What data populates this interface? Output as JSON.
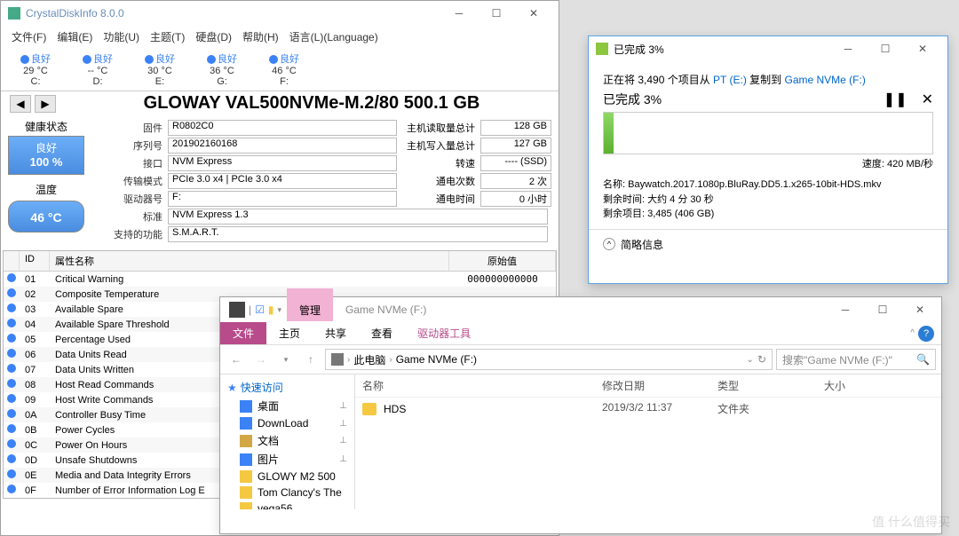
{
  "cdi": {
    "title": "CrystalDiskInfo 8.0.0",
    "menu": [
      "文件(F)",
      "编辑(E)",
      "功能(U)",
      "主题(T)",
      "硬盘(D)",
      "帮助(H)",
      "语言(L)(Language)"
    ],
    "drives": [
      {
        "status": "良好",
        "temp": "29 °C",
        "letter": "C:"
      },
      {
        "status": "良好",
        "temp": "-- °C",
        "letter": "D:"
      },
      {
        "status": "良好",
        "temp": "30 °C",
        "letter": "E:"
      },
      {
        "status": "良好",
        "temp": "36 °C",
        "letter": "G:"
      },
      {
        "status": "良好",
        "temp": "46 °C",
        "letter": "F:"
      }
    ],
    "modelTitle": "GLOWAY VAL500NVMe-M.2/80 500.1 GB",
    "healthLabel": "健康状态",
    "healthStatus": "良好",
    "healthPct": "100 %",
    "tempLabel": "温度",
    "tempVal": "46 °C",
    "fields": {
      "firmware_l": "固件",
      "firmware": "R0802C0",
      "serial_l": "序列号",
      "serial": "201902160168",
      "iface_l": "接口",
      "iface": "NVM Express",
      "transfer_l": "传输模式",
      "transfer": "PCIe 3.0 x4 | PCIe 3.0 x4",
      "drive_l": "驱动器号",
      "drive": "F:",
      "std_l": "标准",
      "std": "NVM Express 1.3",
      "feat_l": "支持的功能",
      "feat": "S.M.A.R.T.",
      "reads_l": "主机读取量总计",
      "reads": "128 GB",
      "writes_l": "主机写入量总计",
      "writes": "127 GB",
      "spin_l": "转速",
      "spin": "---- (SSD)",
      "pon_l": "通电次数",
      "pon": "2 次",
      "hours_l": "通电时间",
      "hours": "0 小时"
    },
    "smartHead": {
      "id": "ID",
      "name": "属性名称",
      "raw": "原始值"
    },
    "smart": [
      {
        "id": "01",
        "name": "Critical Warning",
        "raw": "000000000000"
      },
      {
        "id": "02",
        "name": "Composite Temperature",
        "raw": ""
      },
      {
        "id": "03",
        "name": "Available Spare",
        "raw": ""
      },
      {
        "id": "04",
        "name": "Available Spare Threshold",
        "raw": ""
      },
      {
        "id": "05",
        "name": "Percentage Used",
        "raw": ""
      },
      {
        "id": "06",
        "name": "Data Units Read",
        "raw": ""
      },
      {
        "id": "07",
        "name": "Data Units Written",
        "raw": ""
      },
      {
        "id": "08",
        "name": "Host Read Commands",
        "raw": ""
      },
      {
        "id": "09",
        "name": "Host Write Commands",
        "raw": ""
      },
      {
        "id": "0A",
        "name": "Controller Busy Time",
        "raw": ""
      },
      {
        "id": "0B",
        "name": "Power Cycles",
        "raw": ""
      },
      {
        "id": "0C",
        "name": "Power On Hours",
        "raw": ""
      },
      {
        "id": "0D",
        "name": "Unsafe Shutdowns",
        "raw": ""
      },
      {
        "id": "0E",
        "name": "Media and Data Integrity Errors",
        "raw": ""
      },
      {
        "id": "0F",
        "name": "Number of Error Information Log E",
        "raw": ""
      }
    ]
  },
  "copy": {
    "title": "已完成 3%",
    "line1_a": "正在将 3,490 个项目从 ",
    "line1_src": "PT (E:)",
    "line1_b": " 复制到 ",
    "line1_dst": "Game NVMe (F:)",
    "done": "已完成 3%",
    "speed": "速度: 420 MB/秒",
    "name_l": "名称:",
    "name": "Baywatch.2017.1080p.BluRay.DD5.1.x265-10bit-HDS.mkv",
    "remain_l": "剩余时间:",
    "remain": "大约 4 分 30 秒",
    "items_l": "剩余项目:",
    "items": "3,485 (406 GB)",
    "more": "简略信息"
  },
  "explorer": {
    "tabManage": "管理",
    "tabTitle": "Game NVMe (F:)",
    "ribbon": {
      "file": "文件",
      "home": "主页",
      "share": "共享",
      "view": "查看",
      "tools": "驱动器工具"
    },
    "bc": {
      "pc": "此电脑",
      "loc": "Game NVMe (F:)"
    },
    "searchPh": "搜索\"Game NVMe (F:)\"",
    "side": {
      "quick": "快速访问",
      "desktop": "桌面",
      "download": "DownLoad",
      "doc": "文档",
      "pic": "图片",
      "g1": "GLOWY M2 500",
      "g2": "Tom Clancy's The",
      "g3": "vega56"
    },
    "head": {
      "name": "名称",
      "date": "修改日期",
      "type": "类型",
      "size": "大小"
    },
    "row": {
      "name": "HDS",
      "date": "2019/3/2 11:37",
      "type": "文件夹"
    }
  },
  "watermark": "值 什么值得买"
}
